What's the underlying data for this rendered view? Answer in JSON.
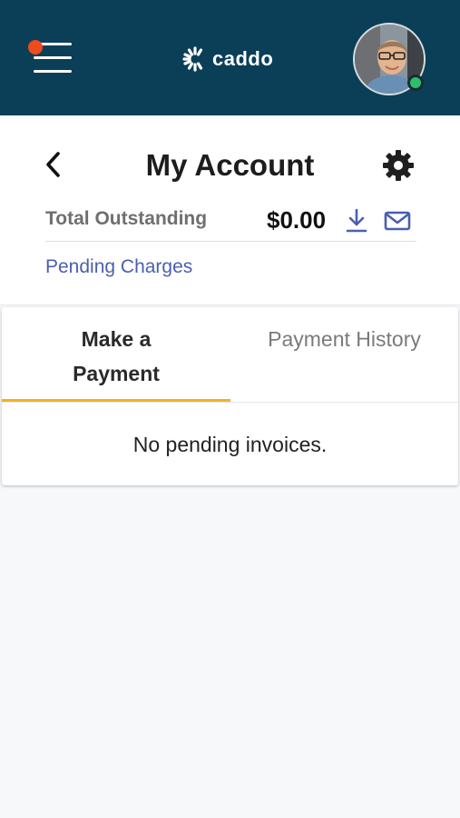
{
  "topbar": {
    "logo_text": "caddo",
    "notification_color": "#f04a1f",
    "bg_color": "#0b3f58",
    "online_status_color": "#2bbf6a"
  },
  "header": {
    "title": "My Account",
    "total_outstanding_label": "Total Outstanding",
    "total_outstanding_amount": "$0.00",
    "pending_charges_link": "Pending Charges"
  },
  "tabs": [
    {
      "label": "Make a Payment",
      "active": true
    },
    {
      "label": "Payment History",
      "active": false
    }
  ],
  "content": {
    "empty_message": "No pending invoices."
  },
  "colors": {
    "accent": "#f0b323",
    "link": "#4a5fb0"
  },
  "icons": [
    "menu-icon",
    "avatar",
    "back-arrow-icon",
    "gear-icon",
    "download-icon",
    "mail-icon"
  ]
}
